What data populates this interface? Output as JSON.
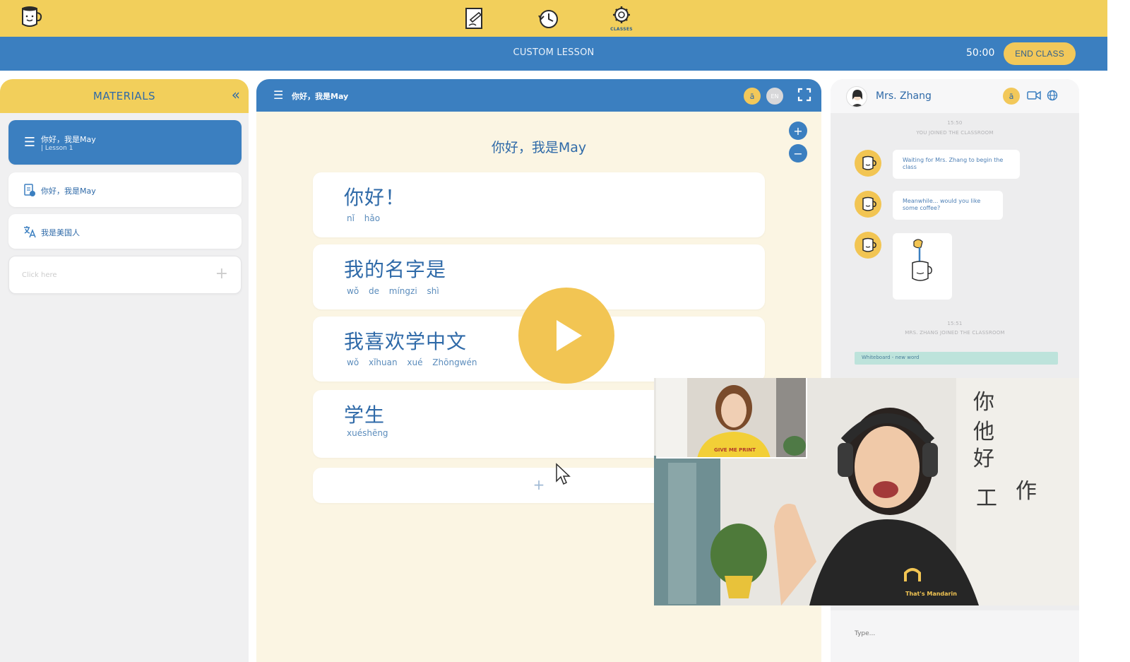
{
  "colors": {
    "yellow": "#f2cf5b",
    "blue": "#3b7fc0",
    "text_blue": "#2f6aa8",
    "board_bg": "#fbf5e3",
    "panel_bg": "#f0f0f1"
  },
  "topbar": {
    "icons": [
      "mug-logo-icon",
      "whiteboard-icon",
      "history-clock-icon",
      "classes-gear-icon"
    ],
    "classes_caption": "CLASSES"
  },
  "lesson_bar": {
    "title": "CUSTOM LESSON",
    "timer": "50:00",
    "end_label": "END CLASS"
  },
  "materials": {
    "title": "MATERIALS",
    "collapse_glyph": "«",
    "items": [
      {
        "title": "你好，我是May",
        "subtitle": "| Lesson 1",
        "icon": "menu-icon",
        "active": true
      },
      {
        "title": "你好，我是May",
        "icon": "document-icon",
        "active": false
      },
      {
        "title": "我是美国人",
        "icon": "translate-icon",
        "active": false
      }
    ],
    "add_placeholder": "Click here",
    "add_glyph": "+"
  },
  "board": {
    "header_name": "你好，我是May",
    "lang_primary": "ă",
    "lang_secondary": "EN",
    "title": "你好，我是May",
    "zoom_in": "+",
    "zoom_out": "−",
    "cards": [
      {
        "hanzi": "你好！",
        "pinyin": "nǐ hǎo"
      },
      {
        "hanzi": "我的名字是",
        "pinyin": "wǒ de míngzi shì"
      },
      {
        "hanzi": "我喜欢学中文",
        "pinyin": "wǒ xǐhuan xué Zhōngwén"
      },
      {
        "hanzi": "学生",
        "pinyin": "xuéshēng"
      }
    ],
    "add_glyph": "+"
  },
  "chat": {
    "teacher_name": "Mrs. Zhang",
    "lang_glyph": "ă",
    "stamp1_time": "15:50",
    "stamp1_text": "YOU JOINED THE CLASSROOM",
    "messages": [
      "Waiting for Mrs. Zhang to begin the class",
      "Meanwhile... would you like some coffee?"
    ],
    "stamp2_time": "15:51",
    "stamp2_text": "MRS. ZHANG JOINED THE CLASSROOM",
    "whiteboard_notice": "Whiteboard - new word",
    "input_placeholder": "Type..."
  },
  "video": {
    "shirt_text": "GIVE ME PRINT",
    "logo_text": "That's Mandarin",
    "whiteboard_chars": [
      "你",
      "他",
      "好",
      "工",
      "作"
    ]
  }
}
